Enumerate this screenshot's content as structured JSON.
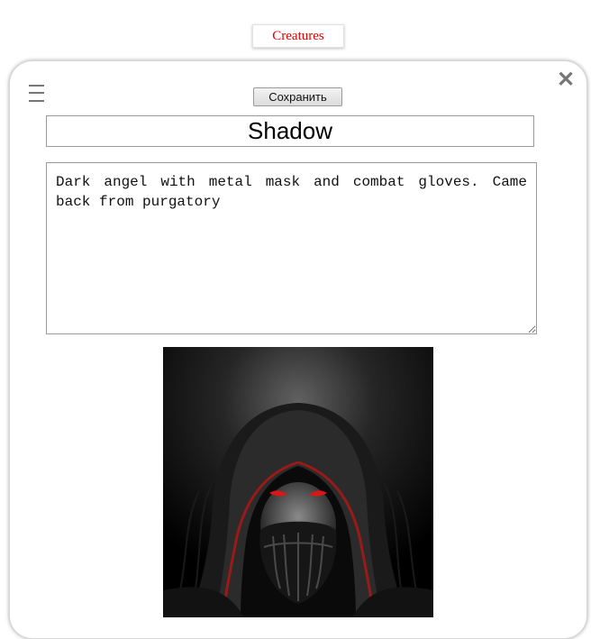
{
  "top_tab": {
    "label": "Creatures"
  },
  "editor": {
    "save_label": "Сохранить",
    "close_symbol": "✕",
    "name_value": "Shadow",
    "description_value": "Dark angel with metal mask and combat gloves. Came back from purgatory"
  },
  "colors": {
    "tab_text": "#e00000",
    "icon_gray": "#777777",
    "mask_eyes": "#d81818"
  },
  "icons": [
    "hamburger-menu-icon",
    "close-icon"
  ]
}
